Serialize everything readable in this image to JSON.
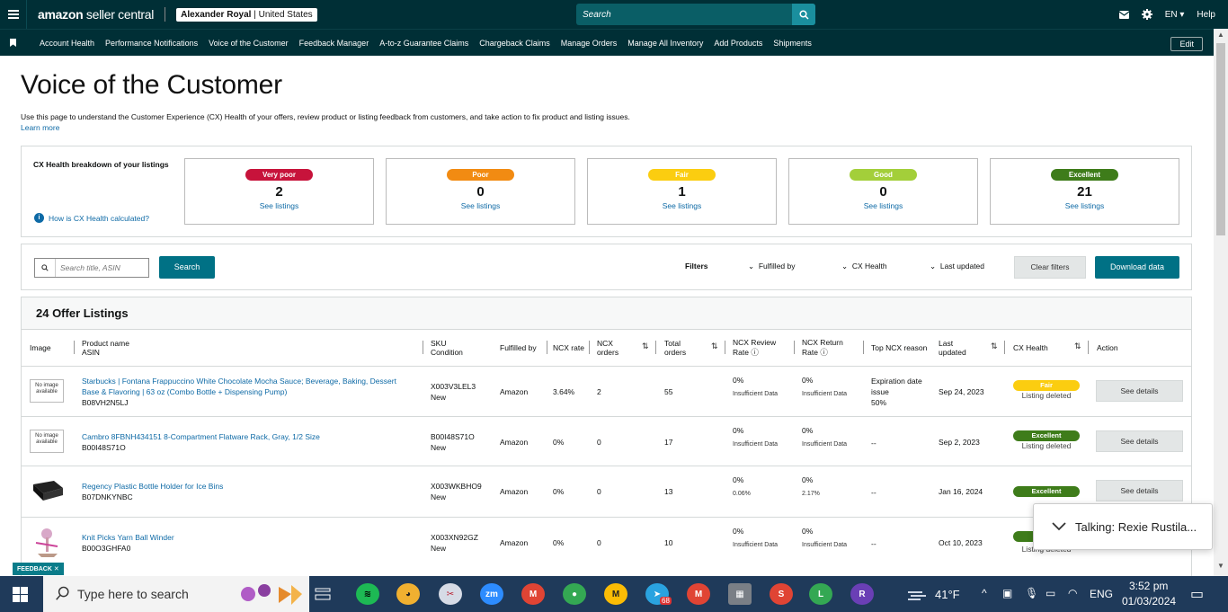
{
  "topbar": {
    "logo_main": "amazon",
    "logo_rest": " seller central",
    "account_name": "Alexander Royal",
    "account_sep": " | ",
    "account_region": "United States",
    "search_placeholder": "Search",
    "lang": "EN",
    "help": "Help"
  },
  "nav": [
    "Account Health",
    "Performance Notifications",
    "Voice of the Customer",
    "Feedback Manager",
    "A-to-z Guarantee Claims",
    "Chargeback Claims",
    "Manage Orders",
    "Manage All Inventory",
    "Add Products",
    "Shipments"
  ],
  "nav_edit": "Edit",
  "page": {
    "title": "Voice of the Customer",
    "description": "Use this page to understand the Customer Experience (CX) Health of your offers, review product or listing feedback from customers, and take action to fix product and listing issues.",
    "learn_more": "Learn more"
  },
  "cx": {
    "title": "CX Health breakdown of your listings",
    "how": "How is CX Health calculated?",
    "cards": [
      {
        "label": "Very poor",
        "count": "2",
        "link": "See listings",
        "color": "#c7133b",
        "text": "#ffffff"
      },
      {
        "label": "Poor",
        "count": "0",
        "link": "See listings",
        "color": "#f28b12",
        "text": "#ffffff"
      },
      {
        "label": "Fair",
        "count": "1",
        "link": "See listings",
        "color": "#fbcd10",
        "text": "#ffffff"
      },
      {
        "label": "Good",
        "count": "0",
        "link": "See listings",
        "color": "#a3cf3a",
        "text": "#ffffff"
      },
      {
        "label": "Excellent",
        "count": "21",
        "link": "See listings",
        "color": "#3e7c1a",
        "text": "#ffffff"
      }
    ]
  },
  "filters": {
    "search_placeholder": "Search title, ASIN",
    "search_button": "Search",
    "label": "Filters",
    "fulfilled": "Fulfilled by",
    "cx": "CX Health",
    "updated": "Last updated",
    "clear": "Clear filters",
    "download": "Download data"
  },
  "table": {
    "title": "24 Offer Listings",
    "headers": {
      "image": "Image",
      "product1": "Product name",
      "product2": "ASIN",
      "sku1": "SKU",
      "sku2": "Condition",
      "fulfilled": "Fulfilled by",
      "ncx_rate": "NCX rate",
      "ncx_orders1": "NCX",
      "ncx_orders2": "orders",
      "total1": "Total",
      "total2": "orders",
      "review1": "NCX Review",
      "review2": "Rate",
      "return1": "NCX Return",
      "return2": "Rate",
      "top_reason": "Top NCX reason",
      "updated1": "Last",
      "updated2": "updated",
      "cx_health": "CX Health",
      "action": "Action"
    },
    "rows": [
      {
        "noimg": "No image available",
        "name": "Starbucks | Fontana Frappuccino White Chocolate Mocha Sauce; Beverage, Baking, Dessert Base & Flavoring | 63 oz (Combo Bottle + Dispensing Pump)",
        "asin": "B08VH2N5LJ",
        "sku": "X003V3LEL3",
        "condition": "New",
        "fulfilled": "Amazon",
        "ncx_rate": "3.64%",
        "ncx_orders": "2",
        "total": "55",
        "review": "0%",
        "review_sub": "Insufficient Data",
        "return": "0%",
        "return_sub": "Insufficient Data",
        "reason": "Expiration date issue",
        "reason_pct": "50%",
        "updated": "Sep 24, 2023",
        "health": "Fair",
        "health_color": "#fbcd10",
        "health_sub": "Listing deleted",
        "action": "See details"
      },
      {
        "noimg": "No image available",
        "name": "Cambro 8FBNH434151 8-Compartment Flatware Rack, Gray, 1/2 Size",
        "asin": "B00I48S71O",
        "sku": "B00I48S71O",
        "condition": "New",
        "fulfilled": "Amazon",
        "ncx_rate": "0%",
        "ncx_orders": "0",
        "total": "17",
        "review": "0%",
        "review_sub": "Insufficient Data",
        "return": "0%",
        "return_sub": "Insufficient Data",
        "reason": "--",
        "reason_pct": "",
        "updated": "Sep 2, 2023",
        "health": "Excellent",
        "health_color": "#3e7c1a",
        "health_sub": "Listing deleted",
        "action": "See details"
      },
      {
        "noimg": "",
        "name": "Regency Plastic Bottle Holder for Ice Bins",
        "asin": "B07DNKYNBC",
        "sku": "X003WKBHO9",
        "condition": "New",
        "fulfilled": "Amazon",
        "ncx_rate": "0%",
        "ncx_orders": "0",
        "total": "13",
        "review": "0%",
        "review_sub": "0.06%",
        "return": "0%",
        "return_sub": "2.17%",
        "reason": "--",
        "reason_pct": "",
        "updated": "Jan 16, 2024",
        "health": "Excellent",
        "health_color": "#3e7c1a",
        "health_sub": "",
        "action": "See details"
      },
      {
        "noimg": "",
        "name": "Knit Picks Yarn Ball Winder",
        "asin": "B00O3GHFA0",
        "sku": "X003XN92GZ",
        "condition": "New",
        "fulfilled": "Amazon",
        "ncx_rate": "0%",
        "ncx_orders": "0",
        "total": "10",
        "review": "0%",
        "review_sub": "Insufficient Data",
        "return": "0%",
        "return_sub": "Insufficient Data",
        "reason": "--",
        "reason_pct": "",
        "updated": "Oct 10, 2023",
        "health": "",
        "health_color": "#3e7c1a",
        "health_sub": "Listing deleted",
        "action": ""
      }
    ]
  },
  "toast": {
    "text": "Talking: Rexie Rustila..."
  },
  "feedback": "FEEDBACK",
  "taskbar": {
    "search": "Type here to search",
    "temp": "41°F",
    "lang": "ENG",
    "time": "3:52 pm",
    "date": "01/03/2024",
    "badge": "68"
  }
}
